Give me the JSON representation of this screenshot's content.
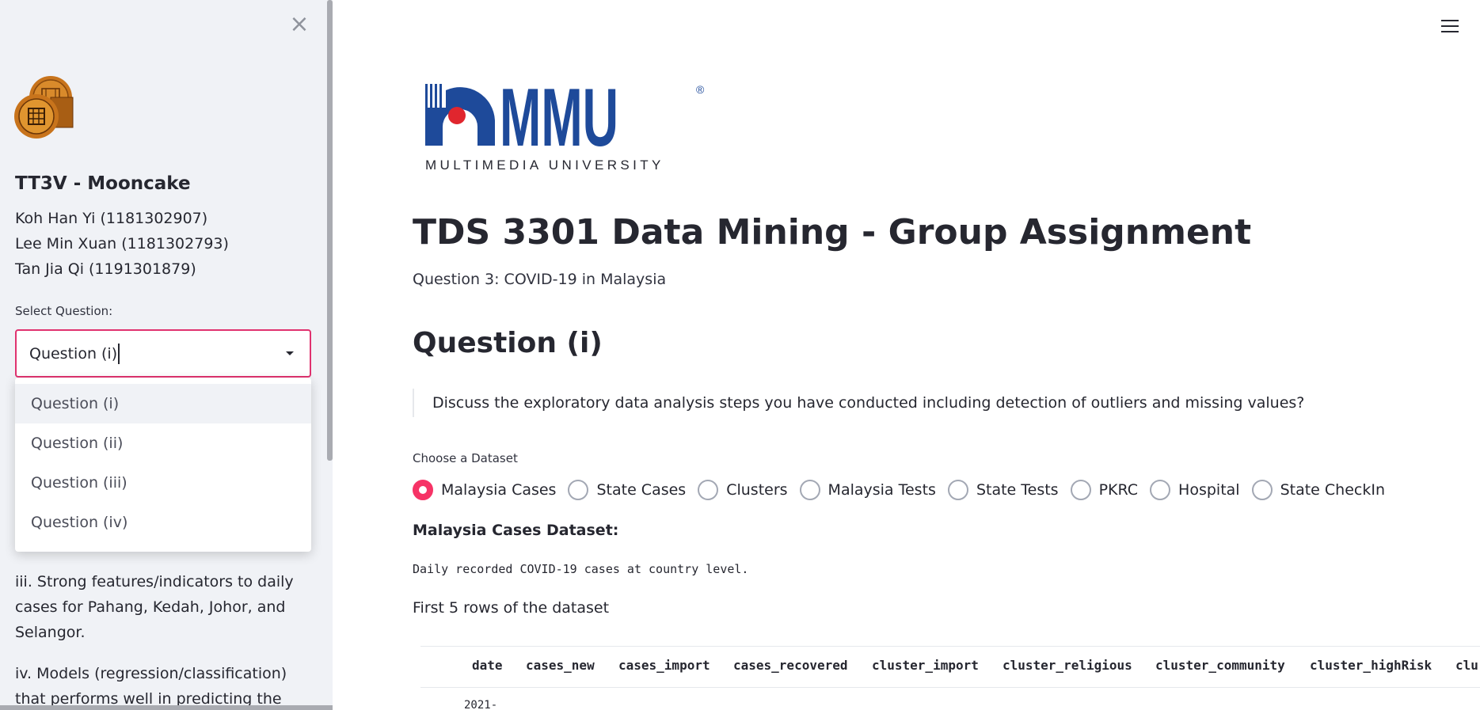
{
  "sidebar": {
    "close_symbol": "×",
    "group_name": "TT3V - Mooncake",
    "members": [
      "Koh Han Yi (1181302907)",
      "Lee Min Xuan (1181302793)",
      "Tan Jia Qi (1191301879)"
    ],
    "select_label": "Select Question:",
    "selected_value": "Question (i)",
    "options": [
      "Question (i)",
      "Question (ii)",
      "Question (iii)",
      "Question (iv)"
    ],
    "text_iii": "iii. Strong features/indicators to daily cases for Pahang, Kedah, Johor, and Selangor.",
    "text_iv": "iv. Models (regression/classification) that performs well in predicting the daily"
  },
  "logo": {
    "brand_text": "MMU",
    "registered": "®",
    "university_name": "MULTIMEDIA UNIVERSITY"
  },
  "main": {
    "title": "TDS 3301 Data Mining - Group Assignment",
    "subtitle": "Question 3: COVID-19 in Malaysia",
    "question_heading": "Question (i)",
    "question_text": "Discuss the exploratory data analysis steps you have conducted including detection of outliers and missing values?",
    "dataset_label": "Choose a Dataset",
    "datasets": [
      "Malaysia Cases",
      "State Cases",
      "Clusters",
      "Malaysia Tests",
      "State Tests",
      "PKRC",
      "Hospital",
      "State CheckIn"
    ],
    "selected_dataset": "Malaysia Cases",
    "dataset_title": "Malaysia Cases Dataset:",
    "dataset_description": "Daily recorded COVID-19 cases at country level.",
    "rows_label": "First 5 rows of the dataset",
    "table": {
      "columns": [
        "date",
        "cases_new",
        "cases_import",
        "cases_recovered",
        "cluster_import",
        "cluster_religious",
        "cluster_community",
        "cluster_highRisk",
        "clu"
      ],
      "first_cell": "2021-"
    }
  },
  "colors": {
    "accent": "#f63366",
    "select_border": "#e0326f",
    "sidebar_bg": "#f0f2f6",
    "mmu_blue": "#1e4a9a",
    "mmu_red": "#e0262e"
  }
}
